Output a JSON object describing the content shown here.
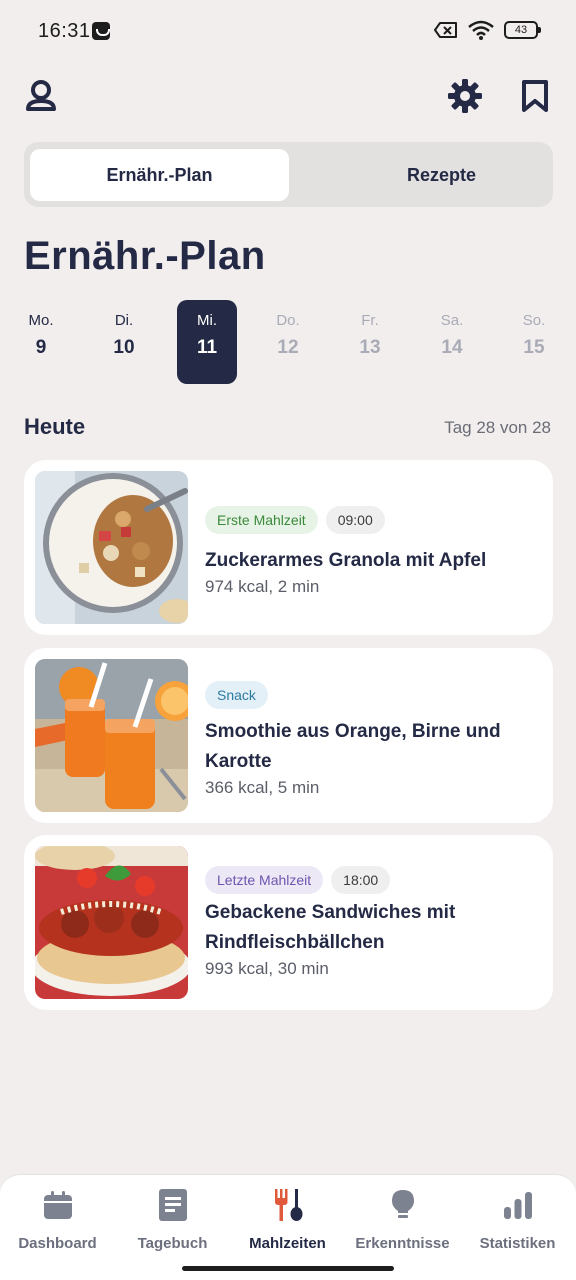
{
  "status_bar": {
    "time": "16:31",
    "battery": "43",
    "icons": [
      "app-notification-icon",
      "no-sim-icon",
      "wifi-icon",
      "battery-icon"
    ]
  },
  "top_bar": {
    "icons": [
      "profile-icon",
      "gear-icon",
      "bookmark-icon"
    ]
  },
  "segmented": {
    "tabs": [
      {
        "label": "Ernähr.-Plan",
        "active": true
      },
      {
        "label": "Rezepte",
        "active": false
      }
    ]
  },
  "page_title": "Ernähr.-Plan",
  "days": [
    {
      "name": "Mo.",
      "num": "9",
      "state": "past"
    },
    {
      "name": "Di.",
      "num": "10",
      "state": "past"
    },
    {
      "name": "Mi.",
      "num": "11",
      "state": "selected"
    },
    {
      "name": "Do.",
      "num": "12",
      "state": "future"
    },
    {
      "name": "Fr.",
      "num": "13",
      "state": "future"
    },
    {
      "name": "Sa.",
      "num": "14",
      "state": "future"
    },
    {
      "name": "So.",
      "num": "15",
      "state": "future"
    }
  ],
  "section": {
    "title": "Heute",
    "progress": "Tag 28 von 28"
  },
  "meals": [
    {
      "tag": "Erste Mahlzeit",
      "time": "09:00",
      "title": "Zuckerarmes Granola mit Apfel",
      "meta": "974 kcal, 2 min",
      "image": "granola-bowl-photo"
    },
    {
      "tag": "Snack",
      "time": "",
      "title": "Smoothie aus Orange, Birne und Karotte",
      "meta": "366 kcal, 5 min",
      "image": "orange-smoothie-photo"
    },
    {
      "tag": "Letzte Mahlzeit",
      "time": "18:00",
      "title": "Gebackene Sandwiches mit Rindfleischbällchen",
      "meta": "993 kcal, 30 min",
      "image": "meatball-sandwich-photo"
    }
  ],
  "bottom_nav": [
    {
      "label": "Dashboard",
      "icon": "calendar-icon",
      "active": false
    },
    {
      "label": "Tagebuch",
      "icon": "journal-icon",
      "active": false
    },
    {
      "label": "Mahlzeiten",
      "icon": "fork-spoon-icon",
      "active": true
    },
    {
      "label": "Erkenntnisse",
      "icon": "lightbulb-icon",
      "active": false
    },
    {
      "label": "Statistiken",
      "icon": "bar-chart-icon",
      "active": false
    }
  ],
  "colors": {
    "primary": "#242a45",
    "background": "#f2eeee",
    "accent": "#e0593a"
  }
}
